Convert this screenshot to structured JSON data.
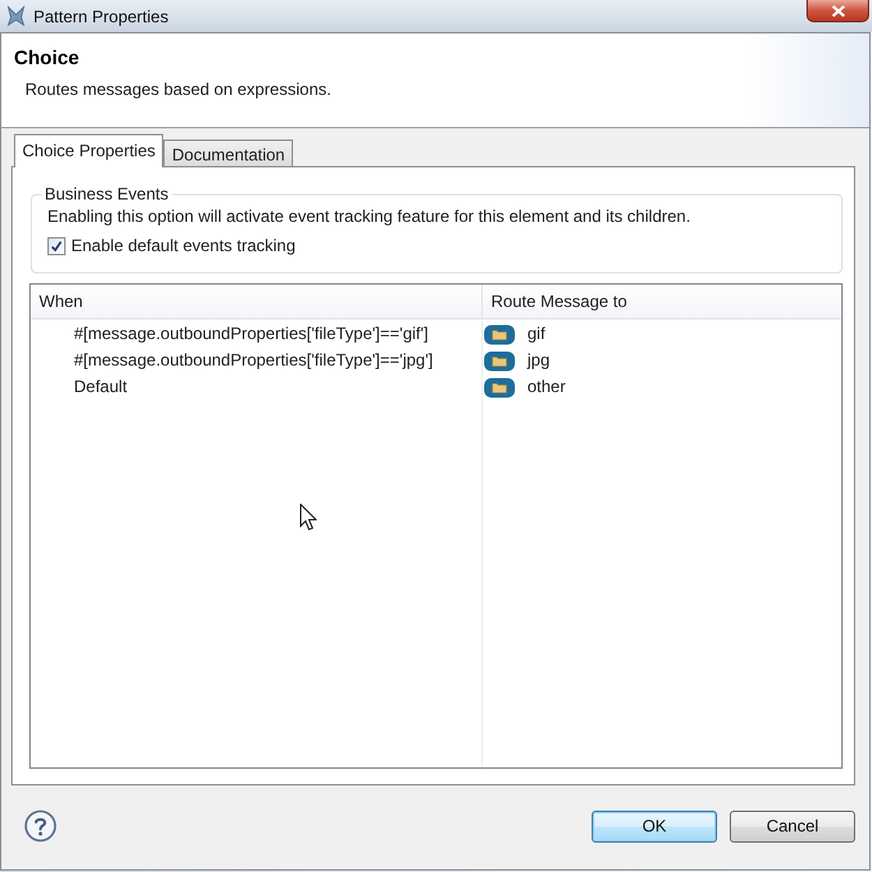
{
  "window": {
    "title": "Pattern Properties"
  },
  "header": {
    "title": "Choice",
    "description": "Routes messages based on expressions."
  },
  "tabs": [
    {
      "label": "Choice Properties",
      "selected": true
    },
    {
      "label": "Documentation",
      "selected": false
    }
  ],
  "business_events": {
    "title": "Business Events",
    "description": "Enabling this option will activate event tracking feature for this element and its children.",
    "checkbox": {
      "label": "Enable default events tracking",
      "checked": true
    }
  },
  "table": {
    "columns": [
      "When",
      "Route Message to"
    ],
    "rows": [
      {
        "when": "#[message.outboundProperties['fileType']=='gif']",
        "route": "gif"
      },
      {
        "when": "#[message.outboundProperties['fileType']=='jpg']",
        "route": "jpg"
      },
      {
        "when": "Default",
        "route": "other"
      }
    ]
  },
  "buttons": [
    {
      "label": "OK",
      "default": true
    },
    {
      "label": "Cancel",
      "default": false
    }
  ]
}
